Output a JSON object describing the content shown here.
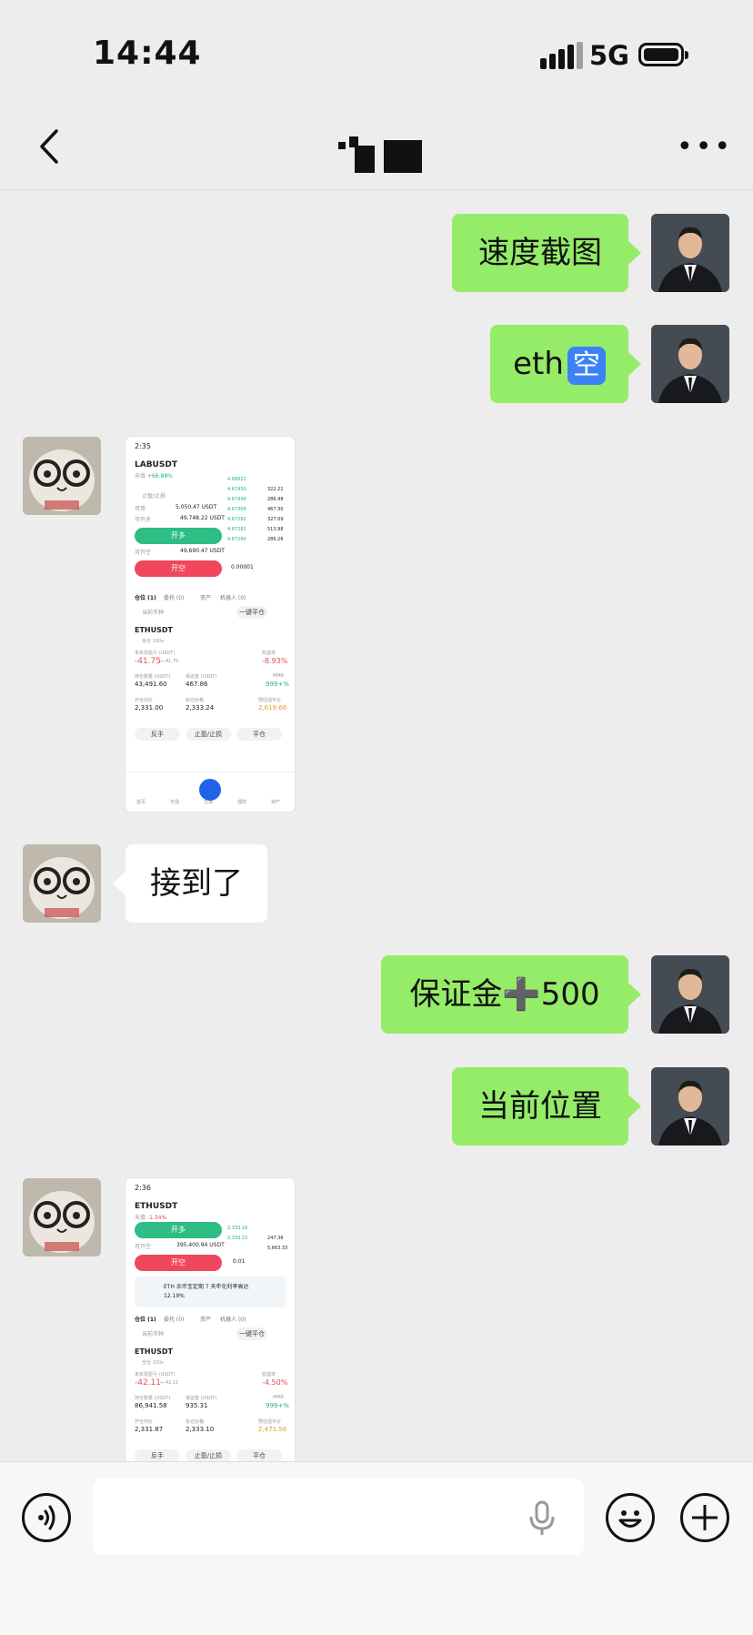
{
  "status_bar": {
    "time": "14:44",
    "network": "5G"
  },
  "nav": {
    "title": "",
    "more_label": "•••"
  },
  "messages": [
    {
      "side": "out",
      "text": "速度截图"
    },
    {
      "side": "out",
      "text": "eth",
      "emoji": "空"
    },
    {
      "side": "in",
      "type": "image"
    },
    {
      "side": "in",
      "text": "接到了"
    },
    {
      "side": "out",
      "text": "保证金➕500"
    },
    {
      "side": "out",
      "text": "当前位置"
    },
    {
      "side": "in",
      "type": "image"
    }
  ],
  "screenshot1": {
    "time": "2:35",
    "pair": "LABUSDT",
    "change": "+66.88%",
    "change_prefix": "未填",
    "mode": "止盈/止损",
    "avail_label": "可用",
    "avail": "5,050.47 USDT",
    "open_label": "可开多",
    "open": "49,748.22 USDT",
    "buy": "开多",
    "short_open_label": "可开空",
    "short_open": "49,690.47 USDT",
    "sell": "开空",
    "qty": "0.00001",
    "book_prices": [
      "4.68821",
      "4.67450",
      "4.67449",
      "4.67309",
      "4.67282",
      "4.67282",
      "4.67260"
    ],
    "book_sizes": [
      "322.21",
      "286.48",
      "467.30",
      "327.09",
      "513.98",
      "286.26"
    ],
    "tabs": [
      "仓位 (1)",
      "委托 (0)",
      "资产",
      "机器人 (0)"
    ],
    "filter": "当前币种",
    "one_click": "一键平仓",
    "position": "ETHUSDT",
    "pos_tags": "全仓 100x",
    "upnl_label": "未实现盈亏 (USDT)",
    "upnl": "-41.75",
    "upnl_sub": "≈-41.75",
    "roe_label": "收益率",
    "roe": "-8.93%",
    "size_label": "持仓数量 (USDT)",
    "size": "43,491.60",
    "margin_label": "保证金 (USDT)",
    "margin": "467.86",
    "mmr_label": "MMR",
    "mmr": "999+%",
    "entry_label": "开仓均价",
    "entry": "2,331.00",
    "mark_label": "标记价格",
    "mark": "2,333.24",
    "liq_label": "预估强平价",
    "liq": "2,619.66",
    "actions": [
      "反手",
      "止盈/止损",
      "平仓"
    ],
    "bottom_nav": [
      "首页",
      "市场",
      "交易",
      "理财",
      "资产"
    ]
  },
  "screenshot2": {
    "time": "2:36",
    "pair": "ETHUSDT",
    "change": "-1.34%",
    "change_prefix": "未填",
    "buy": "开多",
    "short_open_label": "可开空",
    "short_open": "395,400.94 USDT",
    "sell": "开空",
    "qty": "0.01",
    "book_prices": [
      "2,333.16",
      "2,333.15"
    ],
    "book_sizes": [
      "247.36",
      "5,663.33"
    ],
    "promo": "ETH 余币宝定期 7 天年化利率高达",
    "promo_rate": "12.19%",
    "tabs": [
      "仓位 (1)",
      "委托 (0)",
      "资产",
      "机器人 (0)"
    ],
    "filter": "当前币种",
    "one_click": "一键平仓",
    "position": "ETHUSDT",
    "pos_tags": "全仓 100x",
    "upnl_label": "未实现盈亏 (USDT)",
    "upnl": "-42.11",
    "upnl_sub": "≈-42.11",
    "roe_label": "收益率",
    "roe": "-4.50%",
    "size_label": "持仓数量 (USDT)",
    "size": "86,941.58",
    "margin_label": "保证金 (USDT)",
    "margin": "935.31",
    "mmr_label": "MMR",
    "mmr": "999+%",
    "entry_label": "开仓均价",
    "entry": "2,331.87",
    "mark_label": "标记价格",
    "mark": "2,333.10",
    "liq_label": "预估强平价",
    "liq": "2,471.56",
    "actions": [
      "反手",
      "止盈/止损",
      "平仓"
    ]
  },
  "colors": {
    "outgoing_bubble": "#95ec69",
    "incoming_bubble": "#ffffff",
    "background": "#ededed",
    "buy": "#2ebd85",
    "sell": "#f0475c"
  }
}
